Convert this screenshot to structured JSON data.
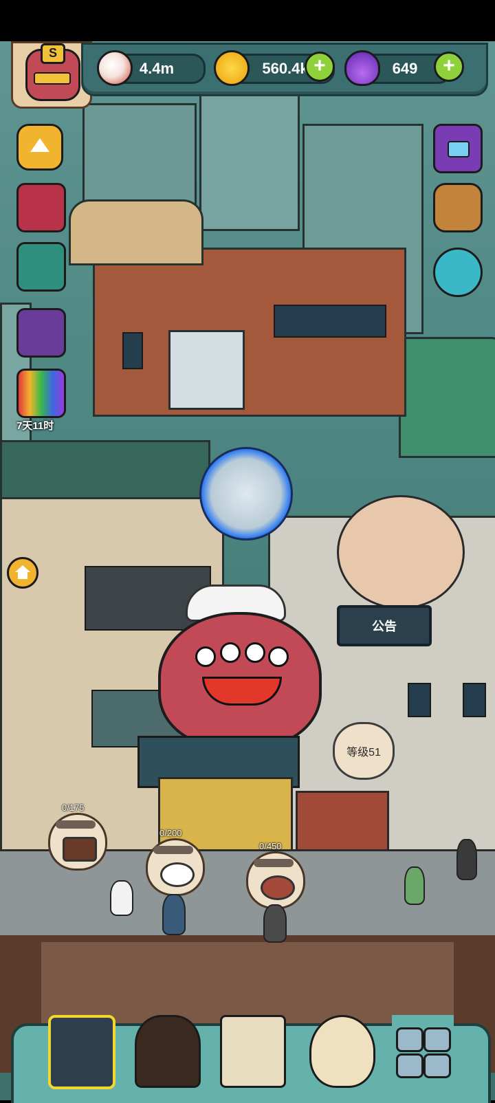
{
  "header": {
    "eyeball_count": "4.4m",
    "coins": "560.4k",
    "potions": "649"
  },
  "sidebar": {
    "event_timer": "7天11时"
  },
  "scene": {
    "notice_sign": "公告",
    "level_bubble": "等级51"
  },
  "orders": [
    {
      "count": "0/175"
    },
    {
      "count": "0/200"
    },
    {
      "count": "0/450"
    }
  ],
  "colors": {
    "plus_button": "#8fd13a",
    "topbar": "#3b6f72",
    "octopus": "#c24a57",
    "portal": "#2f7cf2"
  }
}
